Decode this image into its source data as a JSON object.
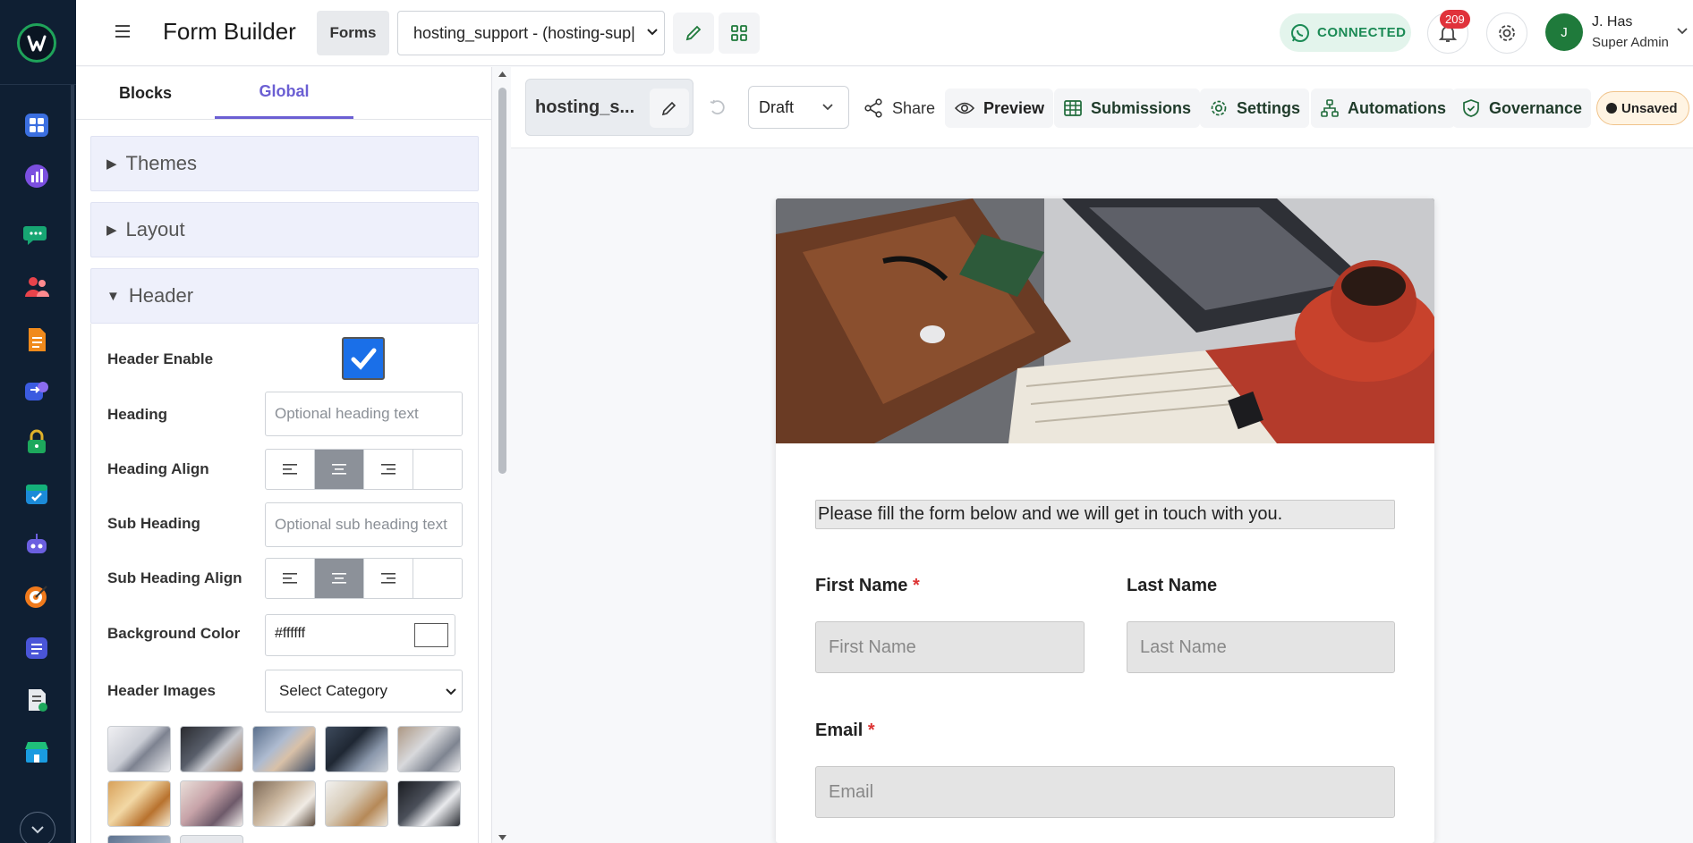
{
  "colors": {
    "nav_bg": "#0f1f33",
    "accent_purple": "#6b5fd3",
    "connected_bg": "#e3f4ec",
    "connected_text": "#1b8a55",
    "badge_red": "#e0323b",
    "avatar_green": "#1f7a3b"
  },
  "leftnav": {
    "icons": [
      "dashboard-icon",
      "analytics-icon",
      "chat-icon",
      "contacts-icon",
      "document-icon",
      "switch-icon",
      "lock-icon",
      "calendar-icon",
      "bot-icon",
      "target-icon",
      "forms-icon",
      "report-icon",
      "store-icon"
    ],
    "more": "chevron-down-icon"
  },
  "header": {
    "title": "Form Builder",
    "forms_button": "Forms",
    "form_select_value": "hosting_support - (hosting-sup|",
    "connected_label": "CONNECTED",
    "notification_count": "209",
    "user_name": "J. Has",
    "user_role": "Super Admin",
    "avatar_initial": "J"
  },
  "sidebar": {
    "tabs": [
      "Blocks",
      "Global"
    ],
    "active_tab": "Global",
    "sections": {
      "themes": "Themes",
      "layout": "Layout",
      "header": "Header"
    },
    "fields": {
      "header_enable": "Header Enable",
      "heading": "Heading",
      "heading_placeholder": "Optional heading text",
      "heading_align": "Heading Align",
      "sub_heading": "Sub Heading",
      "sub_heading_placeholder": "Optional sub heading text",
      "sub_heading_align": "Sub Heading Align",
      "background_color": "Background Color",
      "background_color_value": "#ffffff",
      "header_images": "Header Images",
      "select_category": "Select Category"
    }
  },
  "toolbar": {
    "form_name": "hosting_s...",
    "status": "Draft",
    "share": "Share",
    "preview": "Preview",
    "submissions": "Submissions",
    "settings": "Settings",
    "automations": "Automations",
    "governance": "Governance",
    "unsaved": "Unsaved"
  },
  "form": {
    "intro": "Please fill the form below and we will get in touch with you.",
    "first_name_label": "First Name",
    "first_name_placeholder": "First Name",
    "last_name_label": "Last Name",
    "last_name_placeholder": "Last Name",
    "email_label": "Email",
    "email_placeholder": "Email",
    "required_mark": "*"
  }
}
